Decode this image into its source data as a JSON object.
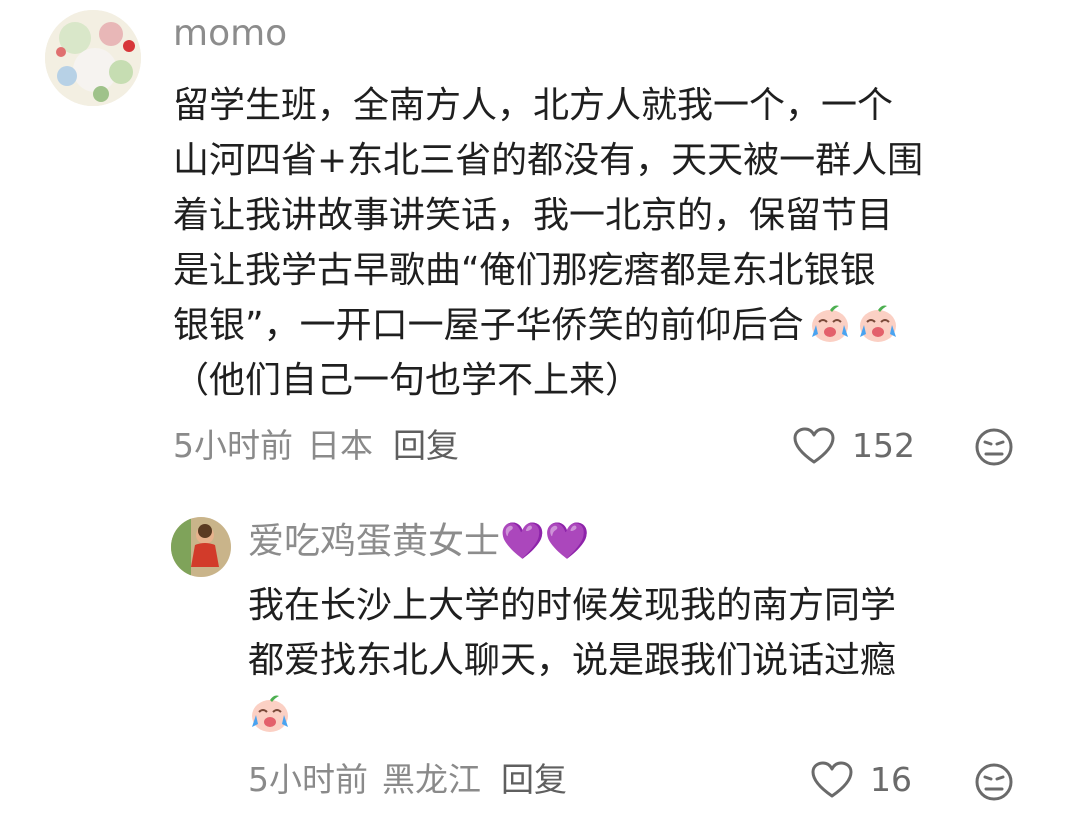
{
  "comments": [
    {
      "username": "momo",
      "avatar_icon": "anime-illustration-avatar",
      "lines": [
        "留学生班，全南方人，北方人就我一个，一个",
        "山河四省+东北三省的都没有，天天被一群人围",
        "着让我讲故事讲笑话，我一北京的，保留节目",
        "是让我学古早歌曲“俺们那疙瘩都是东北银银",
        "银银”，一开口一屋子华侨笑的前仰后合",
        "（他们自己一句也学不上来）"
      ],
      "inline_emojis": [
        "crying-laugh-emoji",
        "crying-laugh-emoji"
      ],
      "time": "5小时前",
      "location": "日本",
      "reply_label": "回复",
      "likes": "152",
      "like_icon": "heart-outline-icon",
      "dislike_icon": "unhappy-face-icon"
    },
    {
      "username": "爱吃鸡蛋黄女士💜💜",
      "avatar_icon": "figure-photo-avatar",
      "lines": [
        "我在长沙上大学的时候发现我的南方同学",
        "都爱找东北人聊天，说是跟我们说话过瘾"
      ],
      "inline_emojis": [
        "crying-laugh-emoji"
      ],
      "time": "5小时前",
      "location": "黑龙江",
      "reply_label": "回复",
      "likes": "16",
      "like_icon": "heart-outline-icon",
      "dislike_icon": "unhappy-face-icon"
    }
  ],
  "colors": {
    "username": "#8c8c8c",
    "meta": "#8a8a8a",
    "body": "#1f1f1f",
    "emoji_face": "#fbd0c4",
    "emoji_tears": "#4aa3f0"
  }
}
